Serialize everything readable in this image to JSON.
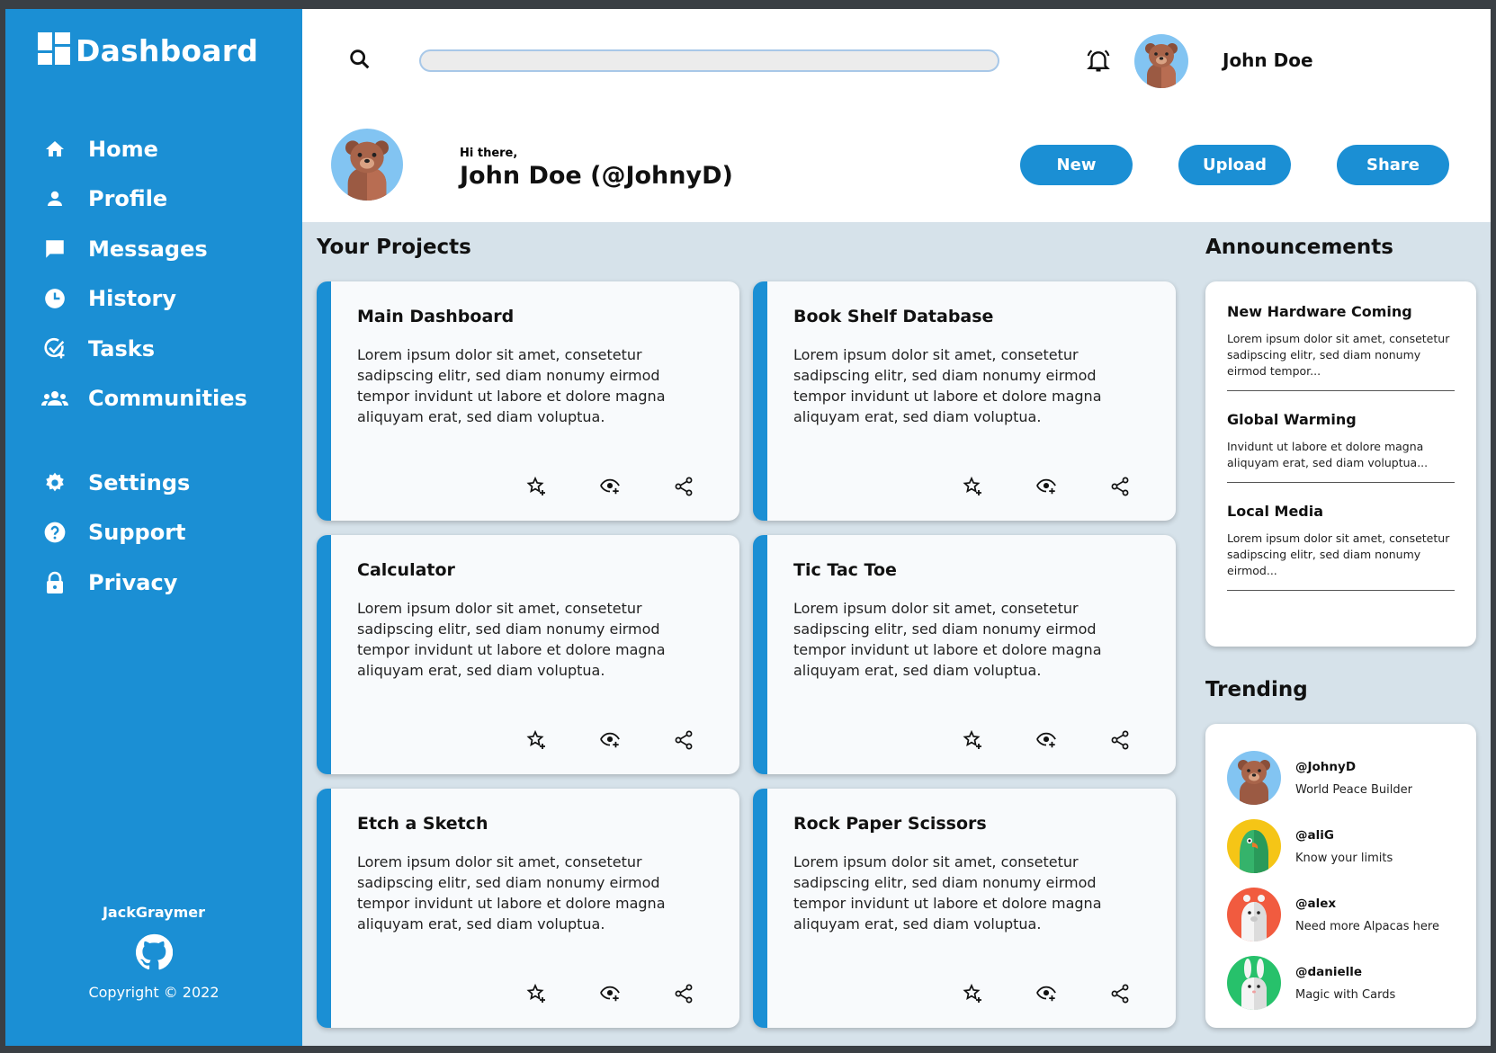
{
  "colors": {
    "primary": "#1b8fd4",
    "background": "#d6e2ea",
    "card": "#f8fafc"
  },
  "sidebar": {
    "brand": "Dashboard",
    "items": [
      {
        "label": "Home",
        "icon": "home-icon"
      },
      {
        "label": "Profile",
        "icon": "person-icon"
      },
      {
        "label": "Messages",
        "icon": "chat-icon"
      },
      {
        "label": "History",
        "icon": "clock-icon"
      },
      {
        "label": "Tasks",
        "icon": "task-check-icon"
      },
      {
        "label": "Communities",
        "icon": "group-icon"
      }
    ],
    "secondary": [
      {
        "label": "Settings",
        "icon": "gear-icon"
      },
      {
        "label": "Support",
        "icon": "help-icon"
      },
      {
        "label": "Privacy",
        "icon": "lock-icon"
      }
    ],
    "footer": {
      "user": "JackGraymer",
      "icon": "github-icon",
      "copyright": "Copyright © 2022"
    }
  },
  "topbar": {
    "search_placeholder": "",
    "user_name": "John Doe"
  },
  "header": {
    "greeting": "Hi there,",
    "name": "John Doe (@JohnyD)",
    "buttons": {
      "new": "New",
      "upload": "Upload",
      "share": "Share"
    }
  },
  "projects": {
    "title": "Your Projects",
    "items": [
      {
        "title": "Main Dashboard",
        "desc": "Lorem ipsum dolor sit amet, consetetur sadipscing elitr, sed diam nonumy eirmod tempor invidunt ut labore et dolore magna aliquyam erat, sed diam voluptua."
      },
      {
        "title": "Book Shelf Database",
        "desc": "Lorem ipsum dolor sit amet, consetetur sadipscing elitr, sed diam nonumy eirmod tempor invidunt ut labore et dolore magna aliquyam erat, sed diam voluptua."
      },
      {
        "title": "Calculator",
        "desc": "Lorem ipsum dolor sit amet, consetetur sadipscing elitr, sed diam nonumy eirmod tempor invidunt ut labore et dolore magna aliquyam erat, sed diam voluptua."
      },
      {
        "title": "Tic Tac Toe",
        "desc": "Lorem ipsum dolor sit amet, consetetur sadipscing elitr, sed diam nonumy eirmod tempor invidunt ut labore et dolore magna aliquyam erat, sed diam voluptua."
      },
      {
        "title": "Etch a Sketch",
        "desc": "Lorem ipsum dolor sit amet, consetetur sadipscing elitr, sed diam nonumy eirmod tempor invidunt ut labore et dolore magna aliquyam erat, sed diam voluptua."
      },
      {
        "title": "Rock Paper Scissors",
        "desc": "Lorem ipsum dolor sit amet, consetetur sadipscing elitr, sed diam nonumy eirmod tempor invidunt ut labore et dolore magna aliquyam erat, sed diam voluptua."
      }
    ]
  },
  "announcements": {
    "title": "Announcements",
    "items": [
      {
        "title": "New Hardware Coming",
        "desc": "Lorem ipsum dolor sit amet, consetetur sadipscing elitr, sed diam nonumy eirmod tempor..."
      },
      {
        "title": "Global Warming",
        "desc": "Invidunt ut labore et dolore magna aliquyam erat, sed diam voluptua..."
      },
      {
        "title": "Local Media",
        "desc": "Lorem ipsum dolor sit amet, consetetur sadipscing elitr, sed diam nonumy eirmod..."
      }
    ]
  },
  "trending": {
    "title": "Trending",
    "items": [
      {
        "handle": "@JohnyD",
        "tagline": "World Peace Builder",
        "avatar": "bear-avatar"
      },
      {
        "handle": "@aliG",
        "tagline": "Know your limits",
        "avatar": "parrot-avatar"
      },
      {
        "handle": "@alex",
        "tagline": "Need more Alpacas here",
        "avatar": "alpaca-avatar"
      },
      {
        "handle": "@danielle",
        "tagline": "Magic with Cards",
        "avatar": "rabbit-avatar"
      }
    ]
  }
}
